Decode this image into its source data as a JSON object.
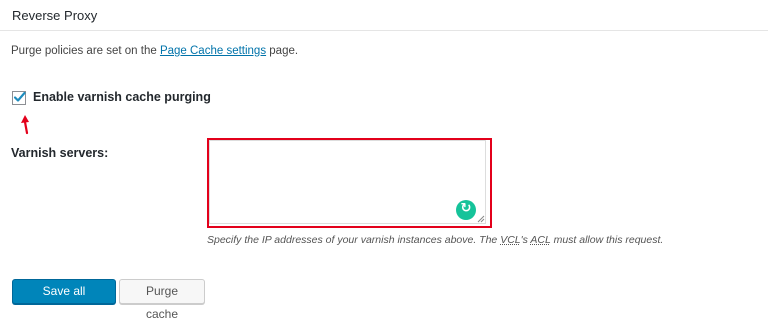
{
  "panel": {
    "title": "Reverse Proxy"
  },
  "description": {
    "prefix": "Purge policies are set on the ",
    "link_text": "Page Cache settings",
    "suffix": " page."
  },
  "varnish_checkbox": {
    "label": "Enable varnish cache purging",
    "checked": true
  },
  "varnish_servers": {
    "label": "Varnish servers:",
    "value": "",
    "hint_part1": "Specify the IP addresses of your varnish instances above. The ",
    "hint_abbr1": "VCL",
    "hint_part2": "'s ",
    "hint_abbr2": "ACL",
    "hint_part3": " must allow this request."
  },
  "buttons": {
    "save": "Save all settings",
    "purge": "Purge cache"
  },
  "colors": {
    "accent": "#0085ba",
    "link": "#0073aa",
    "highlight_border": "#e3001b",
    "grammarly": "#15c39a"
  },
  "icons": {
    "checkbox_check": "checkmark-icon",
    "annotation": "red-arrow-icon",
    "grammarly": "grammarly-icon",
    "resize": "resize-handle-icon"
  }
}
